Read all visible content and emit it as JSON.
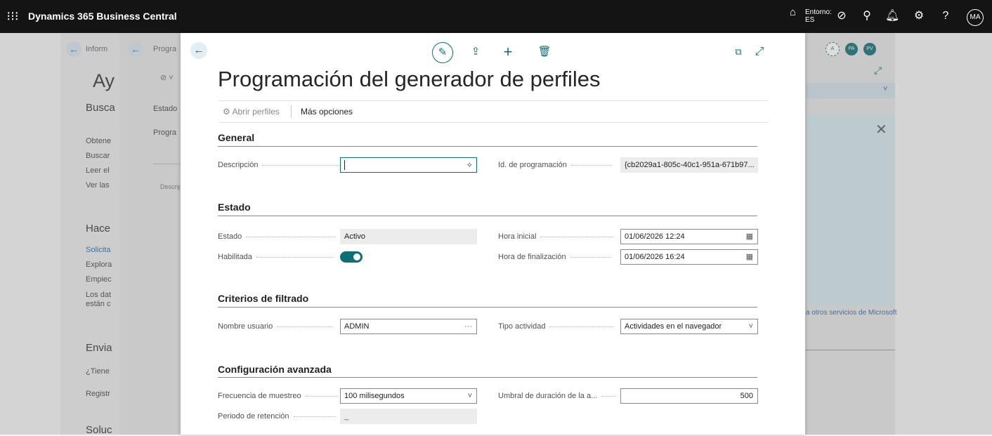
{
  "topbar": {
    "app_name": "Dynamics 365 Business Central",
    "env_label": "Entorno:",
    "env_value": "ES",
    "avatar_initials": "MA",
    "icons": [
      "waffle-icon",
      "environment-icon",
      "copilot-icon",
      "search-icon",
      "bell-icon",
      "settings-icon",
      "help-icon"
    ]
  },
  "background": {
    "layer1": {
      "back_label": "Inform",
      "heading": "Ay",
      "sections": [
        {
          "title": "Busca",
          "items": [
            "Obtene",
            "Buscar",
            "Leer el",
            "Ver las"
          ]
        },
        {
          "title": "Hace",
          "items": [
            "Solicita",
            "Explora",
            "Empiec",
            "Los dat",
            "están c"
          ]
        },
        {
          "title": "Envia",
          "items": [
            "¿Tiene",
            "Registr"
          ]
        },
        {
          "title": "Soluc",
          "items": []
        }
      ]
    },
    "layer2": {
      "back_label": "Progra",
      "field1": "Estado",
      "field2": "Progra",
      "field3": "Descrip"
    },
    "right_panel": {
      "avatars": [
        "A",
        "PA",
        "PV"
      ],
      "link_text": "a otros servicios de Microsoft"
    }
  },
  "dialog": {
    "title": "Programación del generador de perfiles",
    "actions": {
      "open_profiles": "Abrir perfiles",
      "more_options": "Más opciones"
    },
    "sections": {
      "general": "General",
      "estado": "Estado",
      "criterios": "Criterios de filtrado",
      "config": "Configuración avanzada"
    },
    "fields": {
      "descripcion": {
        "label": "Descripción",
        "value": ""
      },
      "id_programacion": {
        "label": "Id. de programación",
        "value": "{cb2029a1-805c-40c1-951a-671b97..."
      },
      "estado": {
        "label": "Estado",
        "value": "Activo"
      },
      "hora_inicial": {
        "label": "Hora inicial",
        "value": "01/06/2026 12:24"
      },
      "habilitada": {
        "label": "Habilitada",
        "value": true
      },
      "hora_final": {
        "label": "Hora de finalización",
        "value": "01/06/2026 16:24"
      },
      "nombre_usuario": {
        "label": "Nombre usuario",
        "value": "ADMIN"
      },
      "tipo_actividad": {
        "label": "Tipo actividad",
        "value": "Actividades en el navegador"
      },
      "frecuencia": {
        "label": "Frecuencia de muestreo",
        "value": "100 milisegundos"
      },
      "umbral": {
        "label": "Umbral de duración de la a...",
        "value": "500"
      },
      "periodo": {
        "label": "Periodo de retención",
        "value": "_"
      }
    }
  },
  "colors": {
    "accent": "#0f6e74",
    "topbar": "#141414"
  }
}
